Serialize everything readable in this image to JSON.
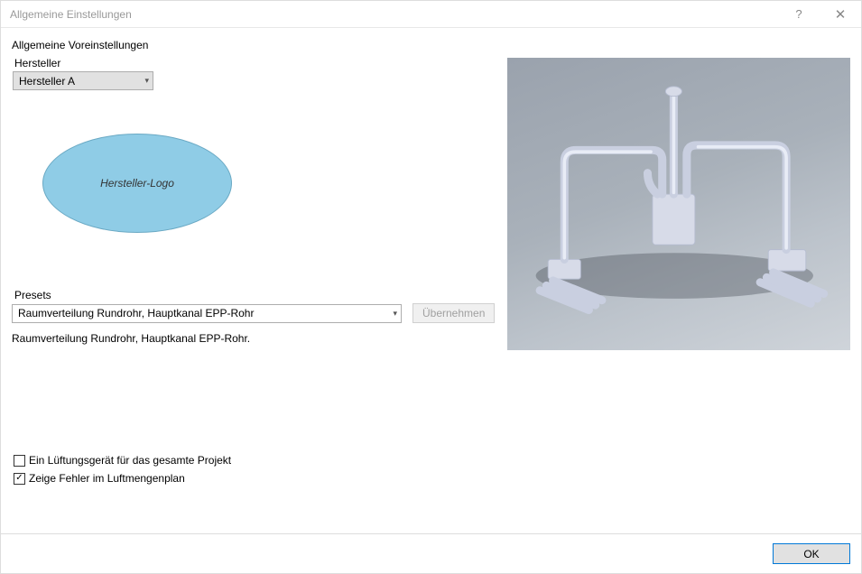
{
  "title": "Allgemeine Einstellungen",
  "section_title": "Allgemeine Voreinstellungen",
  "hersteller": {
    "label": "Hersteller",
    "value": "Hersteller A"
  },
  "logo_text": "Hersteller-Logo",
  "presets": {
    "label": "Presets",
    "value": "Raumverteilung Rundrohr, Hauptkanal EPP-Rohr",
    "apply_label": "Übernehmen",
    "description": "Raumverteilung Rundrohr, Hauptkanal EPP-Rohr."
  },
  "checks": {
    "one_unit": {
      "label": "Ein Lüftungsgerät für das gesamte Projekt",
      "checked": false
    },
    "show_errors": {
      "label": "Zeige Fehler im Luftmengenplan",
      "checked": true
    }
  },
  "ok_label": "OK"
}
